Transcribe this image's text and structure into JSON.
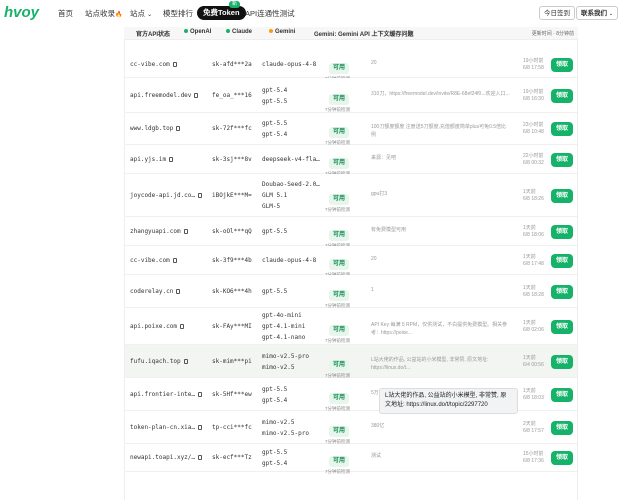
{
  "nav": {
    "logo": "hvoy",
    "home": "首页",
    "directory": "站点收录",
    "fire": "🔥",
    "sites": "站点",
    "caret": "⌄",
    "model_rank": "模型排行",
    "free_token": "免费Token",
    "new_badge": "新",
    "api_test": "API连通性测试",
    "checkin": "今日签到",
    "contact": "联系我们"
  },
  "statusbar": {
    "official_api": "官方API状态",
    "openai": "OpenAI",
    "claude": "Claude",
    "gemini": "Gemini",
    "gemini_note": "Gemini: Gemini API 上下文缓存问题",
    "refresh": "更新时间 · 8分钟前"
  },
  "colors": {
    "accent": "#17b26a",
    "badge_bg": "#e6f6ed",
    "badge_fg": "#118a4c"
  },
  "rows": [
    {
      "site": "cc-vibe.com",
      "key": "sk-afd***2a",
      "models": [
        "claude-opus-4-8"
      ],
      "status": "可用",
      "status_sub": "7分钟前检测",
      "note": "20",
      "time1": "19小时前",
      "time2": "6/8 17:58",
      "claim": "领取"
    },
    {
      "site": "api.freemodel.dev",
      "key": "fe_oa_***16",
      "models": [
        "gpt-5.4",
        "gpt-5.5"
      ],
      "status": "可用",
      "status_sub": "7分钟前检测",
      "note": "310刀，https://freemodel.dev/invite/R8E-68ef24f0...欢迎入口...",
      "time1": "19小时前",
      "time2": "6/8 16:30",
      "claim": "领取"
    },
    {
      "site": "www.ldgb.top",
      "key": "sk-72f***fc",
      "models": [
        "gpt-5.5",
        "gpt-5.4"
      ],
      "status": "可用",
      "status_sub": "7分钟前检测",
      "note": "100刀额度额度 注册送5刀额度,充值额度简单plus可免0.5倍比例",
      "time1": "23小时前",
      "time2": "6/8 10:48",
      "claim": "领取"
    },
    {
      "site": "api.yjs.im",
      "key": "sk-3sj***8v",
      "models": [
        "deepseek-v4-fla…"
      ],
      "status": "可用",
      "status_sub": "7分钟前检测",
      "note": "来源：见吧",
      "time1": "22小时前",
      "time2": "6/8 00:32",
      "claim": "领取"
    },
    {
      "site": "joycode-api.jd.co…",
      "key": "iBOjkE***M=",
      "models": [
        "Doubao-Seed-2.0…",
        "GLM 5.1",
        "GLM-5"
      ],
      "status": "可用",
      "status_sub": "7分钟前检测",
      "note": "gpu打3",
      "time1": "1天前",
      "time2": "6/8 18:26",
      "claim": "领取"
    },
    {
      "site": "zhangyuapi.com",
      "key": "sk-oOl***qQ",
      "models": [
        "gpt-5.5"
      ],
      "status": "可用",
      "status_sub": "7分钟前检测",
      "note": "有免费模型可用",
      "time1": "1天前",
      "time2": "6/8 18:06",
      "claim": "领取"
    },
    {
      "site": "cc-vibe.com",
      "key": "sk-3f9***4b",
      "models": [
        "claude-opus-4-8"
      ],
      "status": "可用",
      "status_sub": "7分钟前检测",
      "note": "20",
      "time1": "1天前",
      "time2": "6/8 17:48",
      "claim": "领取"
    },
    {
      "site": "coderelay.cn",
      "key": "sk-KO6***4h",
      "models": [
        "gpt-5.5"
      ],
      "status": "可用",
      "status_sub": "7分钟前检测",
      "note": "1",
      "time1": "1天前",
      "time2": "6/8 18:28",
      "claim": "领取"
    },
    {
      "site": "api.poixe.com",
      "key": "sk-FAy***MI",
      "models": [
        "gpt-4o-mini",
        "gpt-4.1-mini",
        "gpt-4.1-nano"
      ],
      "status": "可用",
      "status_sub": "7分钟前检测",
      "note": "API Key 每满 5 RPM，仅供测试，不白提供免费模型。相关参考：https://poixe...",
      "time1": "1天前",
      "time2": "6/8 02:06",
      "claim": "领取"
    },
    {
      "site": "fufu.iqach.top",
      "key": "sk-mim***pi",
      "models": [
        "mimo-v2.5-pro",
        "mimo-v2.5"
      ],
      "status": "可用",
      "status_sub": "7分钟前检测",
      "note": "L站大佬的作品, 公益站的小米模型, 非常赞, 原文地址: https://linux.do/t...",
      "time1": "1天前",
      "time2": "6/4 00:56",
      "claim": "领取"
    },
    {
      "site": "api.frontier-inte…",
      "key": "sk-5Hf***ew",
      "models": [
        "gpt-5.5",
        "gpt-5.4"
      ],
      "status": "可用",
      "status_sub": "7分钟前检测",
      "note": "5万",
      "time1": "1天前",
      "time2": "6/8 18:03",
      "claim": "领取"
    },
    {
      "site": "token-plan-cn.xia…",
      "key": "tp-cci***fc",
      "models": [
        "mimo-v2.5",
        "mimo-v2.5-pro"
      ],
      "status": "可用",
      "status_sub": "7分钟前检测",
      "note": "380亿",
      "time1": "2天前",
      "time2": "6/8 17:57",
      "claim": "领取"
    },
    {
      "site": "newapi.toapi.xyz/…",
      "key": "sk-ecf***Tz",
      "models": [
        "gpt-5.5",
        "gpt-5.4"
      ],
      "status": "可用",
      "status_sub": "7分钟前检测",
      "note": "测试",
      "time1": "15小时前",
      "time2": "6/8 17:36",
      "claim": "领取"
    }
  ],
  "tooltip": "L站大佬的作品, 公益站的小米模型, 非常赞, 原文地址: https://linux.do/t/topic/2297720"
}
